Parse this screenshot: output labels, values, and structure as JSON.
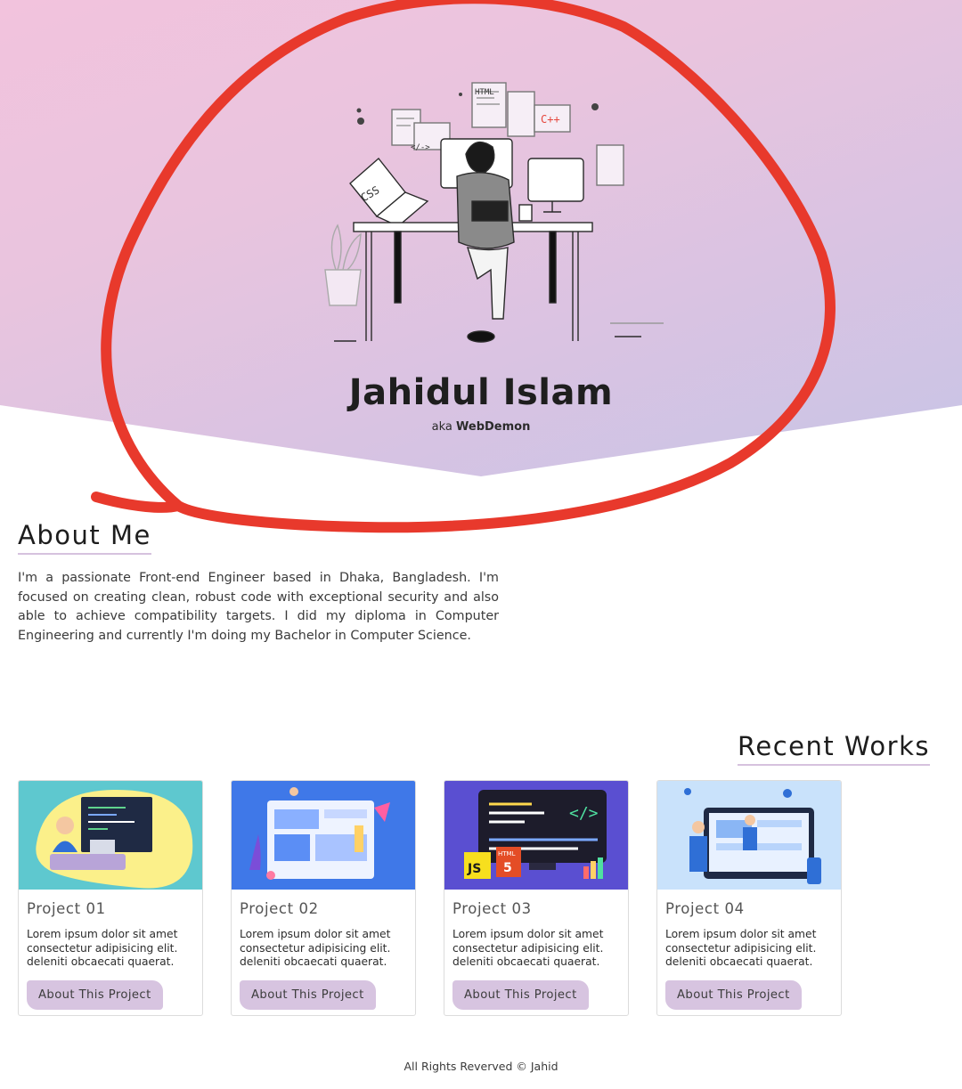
{
  "hero": {
    "name": "Jahidul Islam",
    "aka_prefix": "aka",
    "aka_handle": "WebDemon",
    "illustration": {
      "name": "developer-at-desk-illustration",
      "labels": {
        "html": "HTML",
        "cpp": "C++",
        "css": "CSS",
        "code": "</->"
      }
    },
    "colors": {
      "gradient_start": "#f2c3dd",
      "gradient_end": "#c7c4e6",
      "annotation_stroke": "#e8392c"
    }
  },
  "about": {
    "title": "About Me",
    "text": "I'm a passionate Front-end Engineer based in Dhaka, Bangladesh. I'm focused on creating clean, robust code with exceptional security and also able to achieve compatibility targets. I did my diploma in Computer Engineering and currently I'm doing my Bachelor in Computer Science."
  },
  "works": {
    "title": "Recent Works",
    "projects": [
      {
        "title": "Project 01",
        "description": "Lorem ipsum dolor sit amet consectetur adipisicing elit. deleniti obcaecati quaerat.",
        "button": "About This Project",
        "image": "developer-laptop-illustration"
      },
      {
        "title": "Project 02",
        "description": "Lorem ipsum dolor sit amet consectetur adipisicing elit. deleniti obcaecati quaerat.",
        "button": "About This Project",
        "image": "web-design-illustration"
      },
      {
        "title": "Project 03",
        "description": "Lorem ipsum dolor sit amet consectetur adipisicing elit. deleniti obcaecati quaerat.",
        "button": "About This Project",
        "image": "coding-monitor-illustration",
        "badges": {
          "js": "JS",
          "html": "HTML",
          "html_number": "5",
          "code": "</>"
        }
      },
      {
        "title": "Project 04",
        "description": "Lorem ipsum dolor sit amet consectetur adipisicing elit. deleniti obcaecati quaerat.",
        "button": "About This Project",
        "image": "team-website-illustration"
      }
    ]
  },
  "footer": {
    "text": "All Rights Reverved © Jahid"
  }
}
